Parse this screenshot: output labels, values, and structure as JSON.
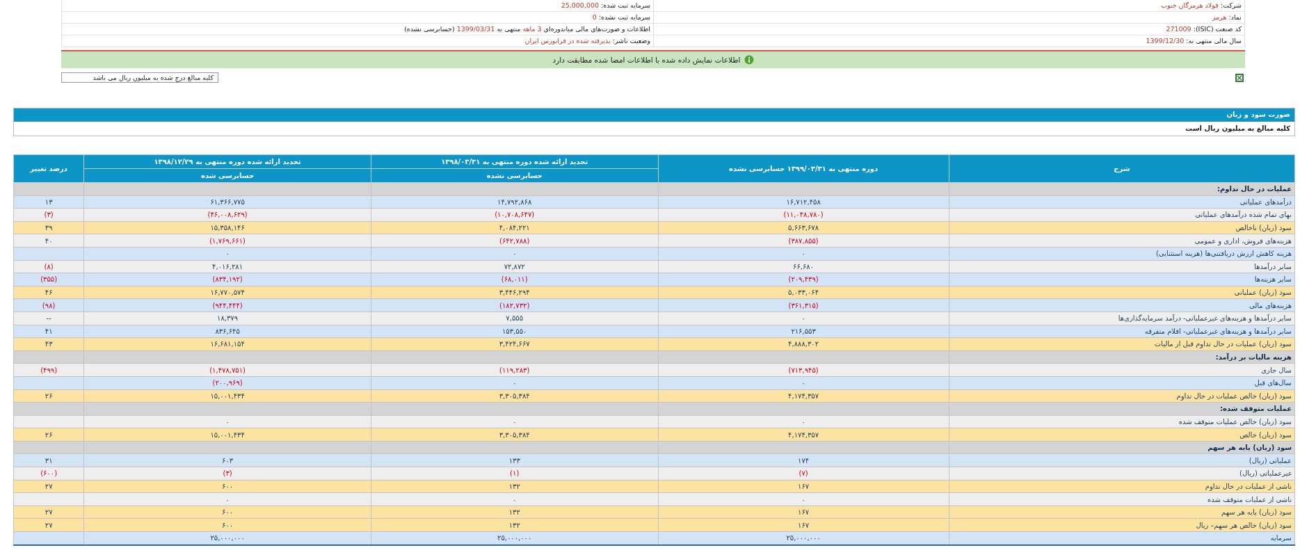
{
  "company_info": {
    "rows": [
      {
        "right": [
          {
            "text": "شرکت:",
            "highlight": false
          },
          {
            "text": "فولاد هرمزگان جنوب",
            "highlight": true
          }
        ],
        "left": [
          {
            "text": "سرمایه ثبت شده:",
            "highlight": false
          },
          {
            "text": "25,000,000",
            "highlight": true
          }
        ]
      },
      {
        "right": [
          {
            "text": "نماد:",
            "highlight": false
          },
          {
            "text": "هرمز",
            "highlight": true
          }
        ],
        "left": [
          {
            "text": "سرمایه ثبت نشده:",
            "highlight": false
          },
          {
            "text": "0",
            "highlight": true
          }
        ]
      },
      {
        "right": [
          {
            "text": "کد صنعت (ISIC):",
            "highlight": false
          },
          {
            "text": "271009",
            "highlight": true
          }
        ],
        "left": [
          {
            "text": "اطلاعات و صورت‌های مالی میاندوره‌ای",
            "highlight": false
          },
          {
            "text": "3 ماهه",
            "highlight": true
          },
          {
            "text": "منتهی به",
            "highlight": false
          },
          {
            "text": "1399/03/31",
            "highlight": true
          },
          {
            "text": "(حسابرسی نشده)",
            "highlight": false
          }
        ]
      },
      {
        "right": [
          {
            "text": "سال مالی منتهی به:",
            "highlight": false
          },
          {
            "text": "1399/12/30",
            "highlight": true
          }
        ],
        "left": [
          {
            "text": "وضعیت ناشر:",
            "highlight": false
          },
          {
            "text": "پذیرفته شده در فرابورس ایران",
            "highlight": true
          }
        ]
      }
    ]
  },
  "verification_banner": {
    "text": "اطلاعات نمایش داده شده با اطلاعات امضا شده مطابقت دارد"
  },
  "amounts_note": "کلیه مبالغ درج شده به میلیون ریال می باشد",
  "statement": {
    "title": "صورت سود و زیان",
    "subtitle": "کلیه مبالغ به میلیون ریال است"
  },
  "table": {
    "columns": [
      {
        "label": "شرح"
      },
      {
        "label": "دوره منتهی به ۱۳۹۹/۰۳/۳۱ حسابرسی نشده"
      },
      {
        "label": "تحدید ارائه شده دوره منتهی به ۱۳۹۸/۰۳/۳۱",
        "sublabel": "حسابرسی نشده"
      },
      {
        "label": "تحدید ارائه شده دوره منتهی به ۱۳۹۸/۱۲/۲۹",
        "sublabel": "حسابرسی شده"
      },
      {
        "label": "درصد تغییر"
      }
    ],
    "rows": [
      {
        "kind": "section",
        "label": "عملیات در حال تداوم:"
      },
      {
        "kind": "shaded",
        "label": "درآمدهای عملیاتی",
        "values": [
          {
            "text": "۱۶,۷۱۲,۴۵۸",
            "negative": false
          },
          {
            "text": "۱۴,۷۹۲,۸۶۸",
            "negative": false
          },
          {
            "text": "۶۱,۳۶۶,۷۷۵",
            "negative": false
          }
        ],
        "change": {
          "text": "۱۳",
          "negative": false
        }
      },
      {
        "kind": "plain",
        "label": "بهای تمام شده درآمدهای عملیاتی",
        "values": [
          {
            "text": "(۱۱,۰۴۸,۷۸۰)",
            "negative": true
          },
          {
            "text": "(۱۰,۷۰۸,۶۴۷)",
            "negative": true
          },
          {
            "text": "(۴۶,۰۰۸,۶۲۹)",
            "negative": true
          }
        ],
        "change": {
          "text": "(۳)",
          "negative": true
        }
      },
      {
        "kind": "total",
        "label": "سود (زیان) ناخالص",
        "values": [
          {
            "text": "۵,۶۶۳,۶۷۸",
            "negative": false
          },
          {
            "text": "۴,۰۸۴,۲۲۱",
            "negative": false
          },
          {
            "text": "۱۵,۳۵۸,۱۴۶",
            "negative": false
          }
        ],
        "change": {
          "text": "۳۹",
          "negative": false
        }
      },
      {
        "kind": "plain",
        "label": "هزینه‌های فروش، اداری و عمومی",
        "values": [
          {
            "text": "(۳۸۷,۸۵۵)",
            "negative": true
          },
          {
            "text": "(۶۴۲,۷۸۸)",
            "negative": true
          },
          {
            "text": "(۱,۷۶۹,۶۶۱)",
            "negative": true
          }
        ],
        "change": {
          "text": "۴۰",
          "negative": false
        }
      },
      {
        "kind": "shaded",
        "label": "هزینه کاهش ارزش دریافتنی‌ها (هزینه استثنایی)",
        "values": [
          {
            "text": "۰",
            "negative": false
          },
          {
            "text": "۰",
            "negative": false
          },
          {
            "text": "۰",
            "negative": false
          }
        ]
      },
      {
        "kind": "plain",
        "label": "سایر درآمدها",
        "values": [
          {
            "text": "۶۶,۶۸۰",
            "negative": false
          },
          {
            "text": "۷۲,۸۷۲",
            "negative": false
          },
          {
            "text": "۴,۰۱۶,۲۸۱",
            "negative": false
          }
        ],
        "change": {
          "text": "(۸)",
          "negative": true
        }
      },
      {
        "kind": "shaded",
        "label": "سایر هزینه‌ها",
        "values": [
          {
            "text": "(۲۰۹,۴۳۹)",
            "negative": true
          },
          {
            "text": "(۶۸,۰۱۱)",
            "negative": true
          },
          {
            "text": "(۸۳۴,۱۹۲)",
            "negative": true
          }
        ],
        "change": {
          "text": "(۳۵۵)",
          "negative": true
        }
      },
      {
        "kind": "total",
        "label": "سود (زیان) عملیاتی",
        "values": [
          {
            "text": "۵,۰۳۳,۰۶۴",
            "negative": false
          },
          {
            "text": "۳,۴۴۶,۲۹۴",
            "negative": false
          },
          {
            "text": "۱۶,۷۷۰,۵۷۴",
            "negative": false
          }
        ],
        "change": {
          "text": "۴۶",
          "negative": false
        }
      },
      {
        "kind": "shaded",
        "label": "هزینه‌های مالی",
        "values": [
          {
            "text": "(۳۶۱,۳۱۵)",
            "negative": true
          },
          {
            "text": "(۱۸۲,۷۳۲)",
            "negative": true
          },
          {
            "text": "(۹۴۴,۴۴۴)",
            "negative": true
          }
        ],
        "change": {
          "text": "(۹۸)",
          "negative": true
        }
      },
      {
        "kind": "plain",
        "label": "سایر درآمدها و هزینه‌های غیرعملیاتی- درآمد سرمایه‌گذاری‌ها",
        "values": [
          {
            "text": "۰",
            "negative": false
          },
          {
            "text": "۷,۵۵۵",
            "negative": false
          },
          {
            "text": "۱۸,۳۷۹",
            "negative": false
          }
        ],
        "change": {
          "text": "--",
          "negative": false
        }
      },
      {
        "kind": "shaded",
        "label": "سایر درآمدها و هزینه‌های غیرعملیاتی- اقلام متفرقه",
        "values": [
          {
            "text": "۲۱۶,۵۵۳",
            "negative": false
          },
          {
            "text": "۱۵۳,۵۵۰",
            "negative": false
          },
          {
            "text": "۸۳۶,۶۴۵",
            "negative": false
          }
        ],
        "change": {
          "text": "۴۱",
          "negative": false
        }
      },
      {
        "kind": "total",
        "label": "سود (زیان) عملیات در حال تداوم قبل از مالیات",
        "values": [
          {
            "text": "۴,۸۸۸,۳۰۲",
            "negative": false
          },
          {
            "text": "۳,۴۲۴,۶۶۷",
            "negative": false
          },
          {
            "text": "۱۶,۶۸۱,۱۵۴",
            "negative": false
          }
        ],
        "change": {
          "text": "۴۳",
          "negative": false
        }
      },
      {
        "kind": "section",
        "label": "هزینه مالیات بر درآمد:"
      },
      {
        "kind": "plain",
        "label": "سال جاری",
        "values": [
          {
            "text": "(۷۱۳,۹۴۵)",
            "negative": true
          },
          {
            "text": "(۱۱۹,۲۸۳)",
            "negative": true
          },
          {
            "text": "(۱,۴۷۸,۷۵۱)",
            "negative": true
          }
        ],
        "change": {
          "text": "(۴۹۹)",
          "negative": true
        }
      },
      {
        "kind": "shaded",
        "label": "سال‌های قبل",
        "values": [
          {
            "text": "۰",
            "negative": false
          },
          {
            "text": "۰",
            "negative": false
          },
          {
            "text": "(۲۰۰,۹۶۹)",
            "negative": true
          }
        ]
      },
      {
        "kind": "total",
        "label": "سود (زیان) خالص عملیات در حال تداوم",
        "values": [
          {
            "text": "۴,۱۷۴,۳۵۷",
            "negative": false
          },
          {
            "text": "۳,۳۰۵,۳۸۴",
            "negative": false
          },
          {
            "text": "۱۵,۰۰۱,۴۳۴",
            "negative": false
          }
        ],
        "change": {
          "text": "۲۶",
          "negative": false
        }
      },
      {
        "kind": "section",
        "label": "عملیات متوقف شده:"
      },
      {
        "kind": "plain",
        "label": "سود (زیان) خالص عملیات متوقف شده",
        "values": [
          {
            "text": "۰",
            "negative": false
          },
          {
            "text": "۰",
            "negative": false
          },
          {
            "text": "۰",
            "negative": false
          }
        ]
      },
      {
        "kind": "total",
        "label": "سود (زیان) خالص",
        "values": [
          {
            "text": "۴,۱۷۴,۳۵۷",
            "negative": false
          },
          {
            "text": "۳,۳۰۵,۳۸۴",
            "negative": false
          },
          {
            "text": "۱۵,۰۰۱,۴۳۴",
            "negative": false
          }
        ],
        "change": {
          "text": "۲۶",
          "negative": false
        }
      },
      {
        "kind": "section",
        "label": "سود (زیان) پایه هر سهم"
      },
      {
        "kind": "shaded",
        "label": "عملیاتی (ریال)",
        "values": [
          {
            "text": "۱۷۴",
            "negative": false
          },
          {
            "text": "۱۳۳",
            "negative": false
          },
          {
            "text": "۶۰۳",
            "negative": false
          }
        ],
        "change": {
          "text": "۳۱",
          "negative": false
        }
      },
      {
        "kind": "plain",
        "label": "غیرعملیاتی (ریال)",
        "values": [
          {
            "text": "(۷)",
            "negative": true
          },
          {
            "text": "(۱)",
            "negative": true
          },
          {
            "text": "(۳)",
            "negative": true
          }
        ],
        "change": {
          "text": "(۶۰۰)",
          "negative": true
        }
      },
      {
        "kind": "total",
        "label": "ناشی از عملیات در حال تداوم",
        "values": [
          {
            "text": "۱۶۷",
            "negative": false
          },
          {
            "text": "۱۳۲",
            "negative": false
          },
          {
            "text": "۶۰۰",
            "negative": false
          }
        ],
        "change": {
          "text": "۲۷",
          "negative": false
        }
      },
      {
        "kind": "plain",
        "label": "ناشی از عملیات متوقف شده",
        "values": [
          {
            "text": "۰",
            "negative": false
          },
          {
            "text": "۰",
            "negative": false
          },
          {
            "text": "۰",
            "negative": false
          }
        ]
      },
      {
        "kind": "total",
        "label": "سود (زیان) پایه هر سهم",
        "values": [
          {
            "text": "۱۶۷",
            "negative": false
          },
          {
            "text": "۱۳۲",
            "negative": false
          },
          {
            "text": "۶۰۰",
            "negative": false
          }
        ],
        "change": {
          "text": "۲۷",
          "negative": false
        }
      },
      {
        "kind": "total",
        "label": "سود (زیان) خالص هر سهم– ریال",
        "values": [
          {
            "text": "۱۶۷",
            "negative": false
          },
          {
            "text": "۱۳۲",
            "negative": false
          },
          {
            "text": "۶۰۰",
            "negative": false
          }
        ],
        "change": {
          "text": "۲۷",
          "negative": false
        }
      },
      {
        "kind": "shaded",
        "label": "سرمایه",
        "values": [
          {
            "text": "۲۵,۰۰۰,۰۰۰",
            "negative": false
          },
          {
            "text": "۲۵,۰۰۰,۰۰۰",
            "negative": false
          },
          {
            "text": "۲۵,۰۰۰,۰۰۰",
            "negative": false
          }
        ]
      }
    ]
  }
}
